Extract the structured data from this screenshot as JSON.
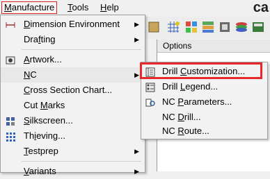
{
  "menubar": {
    "items": [
      {
        "label": "Manufacture",
        "mnemonic": "M",
        "rest": "anufacture",
        "active": true
      },
      {
        "label": "Tools",
        "mnemonic": "T",
        "rest": "ools"
      },
      {
        "label": "Help",
        "mnemonic": "H",
        "rest": "elp"
      }
    ],
    "logo_text": "ca"
  },
  "options_panel": {
    "title": "Options"
  },
  "manufacture_menu": {
    "items": [
      {
        "pre": "",
        "mn": "D",
        "post": "imension Environment",
        "label": "Dimension Environment",
        "icon": "dimension-icon",
        "has_submenu": true
      },
      {
        "pre": "Dra",
        "mn": "f",
        "post": "ting",
        "label": "Drafting",
        "has_submenu": true
      },
      {
        "pre": "",
        "mn": "A",
        "post": "rtwork...",
        "label": "Artwork...",
        "icon": "artwork-icon"
      },
      {
        "pre": "",
        "mn": "N",
        "post": "C",
        "label": "NC",
        "has_submenu": true
      },
      {
        "pre": "",
        "mn": "C",
        "post": "ross Section Chart...",
        "label": "Cross Section Chart..."
      },
      {
        "pre": "Cut ",
        "mn": "M",
        "post": "arks",
        "label": "Cut Marks"
      },
      {
        "pre": "",
        "mn": "S",
        "post": "ilkscreen...",
        "label": "Silkscreen...",
        "icon": "silkscreen-icon"
      },
      {
        "pre": "Th",
        "mn": "i",
        "post": "eving...",
        "label": "Thieving...",
        "icon": "thieving-icon"
      },
      {
        "pre": "",
        "mn": "T",
        "post": "estprep",
        "label": "Testprep",
        "has_submenu": true
      },
      {
        "pre": "",
        "mn": "V",
        "post": "ariants",
        "label": "Variants",
        "has_submenu": true
      }
    ]
  },
  "nc_submenu": {
    "items": [
      {
        "pre": "Drill ",
        "mn": "C",
        "post": "ustomization...",
        "label": "Drill Customization...",
        "icon": "drill-customization-icon",
        "highlighted": true
      },
      {
        "pre": "Drill ",
        "mn": "L",
        "post": "egend...",
        "label": "Drill Legend...",
        "icon": "drill-legend-icon"
      },
      {
        "pre": "NC ",
        "mn": "P",
        "post": "arameters...",
        "label": "NC Parameters...",
        "icon": "nc-parameters-icon"
      },
      {
        "pre": "NC ",
        "mn": "D",
        "post": "rill...",
        "label": "NC Drill..."
      },
      {
        "pre": "NC ",
        "mn": "R",
        "post": "oute...",
        "label": "NC Route..."
      }
    ]
  },
  "colors": {
    "highlight_border": "#e8282c",
    "menu_bg": "#f2f2f2"
  }
}
